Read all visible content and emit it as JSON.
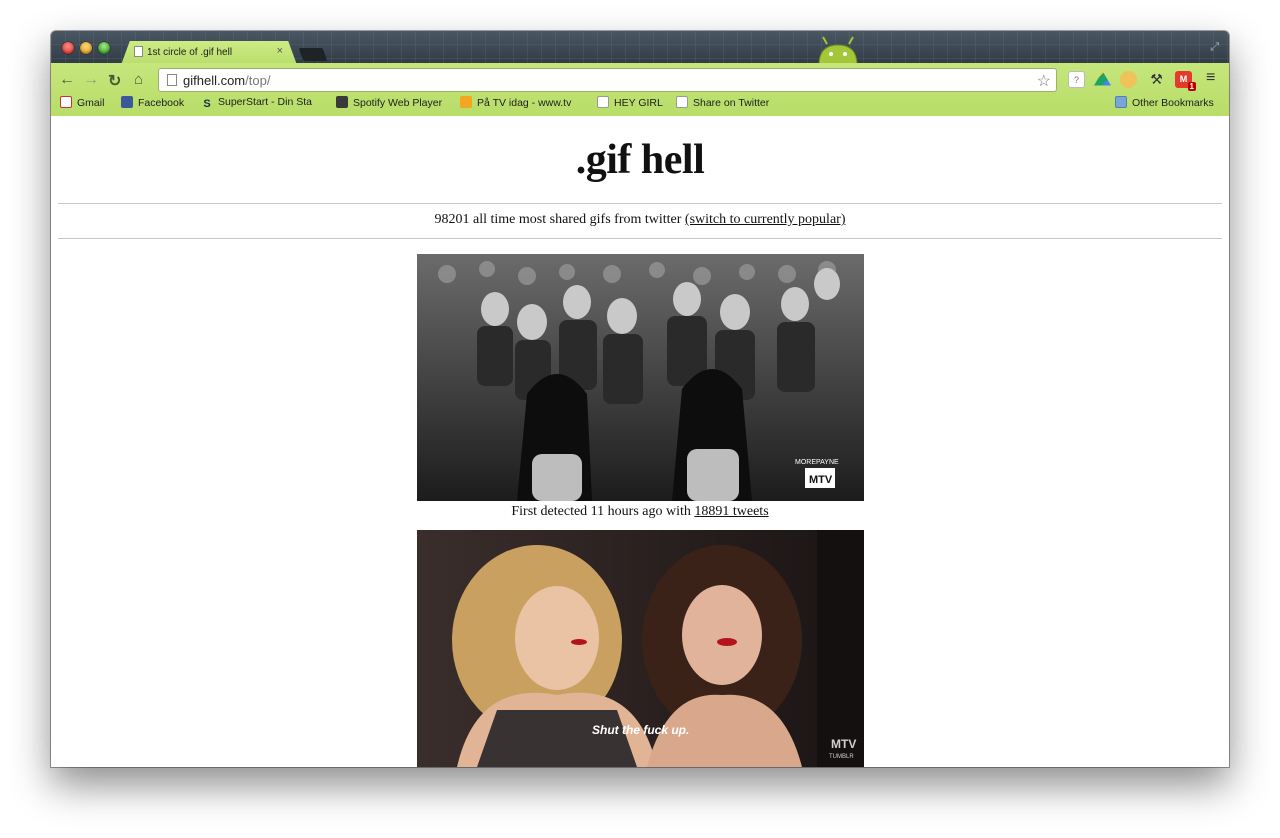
{
  "browser": {
    "tab_title": "1st circle of .gif hell",
    "tab_close": "×",
    "url_host": "gifhell.com",
    "url_path": "/top/",
    "bookmarks": [
      {
        "label": "Gmail",
        "icon": "gmail-icon"
      },
      {
        "label": "Facebook",
        "icon": "facebook-icon"
      },
      {
        "label": "SuperStart - Din Sta",
        "icon": "superstart-icon"
      },
      {
        "label": "Spotify Web Player",
        "icon": "spotify-icon"
      },
      {
        "label": "På TV idag - www.tv",
        "icon": "tv-icon"
      },
      {
        "label": "HEY GIRL",
        "icon": "document-icon"
      },
      {
        "label": "Share on Twitter",
        "icon": "document-icon"
      }
    ],
    "other_bookmarks": "Other Bookmarks",
    "ext_help": "?",
    "mail_badge": "1"
  },
  "page": {
    "site_title": ".gif hell",
    "subtitle_text": "98201 all time most shared gifs from twitter ",
    "subtitle_link": "(switch to currently popular)",
    "gifs": [
      {
        "caption_prefix": "First detected 11 hours ago with ",
        "tweets_link": "18891 tweets",
        "watermark_1": "MOREPAYNE",
        "watermark_2": "MTV"
      },
      {
        "overlay": "Shut the fuck up.",
        "watermark_1": "MTV",
        "watermark_2": "TUMBLR"
      }
    ]
  }
}
